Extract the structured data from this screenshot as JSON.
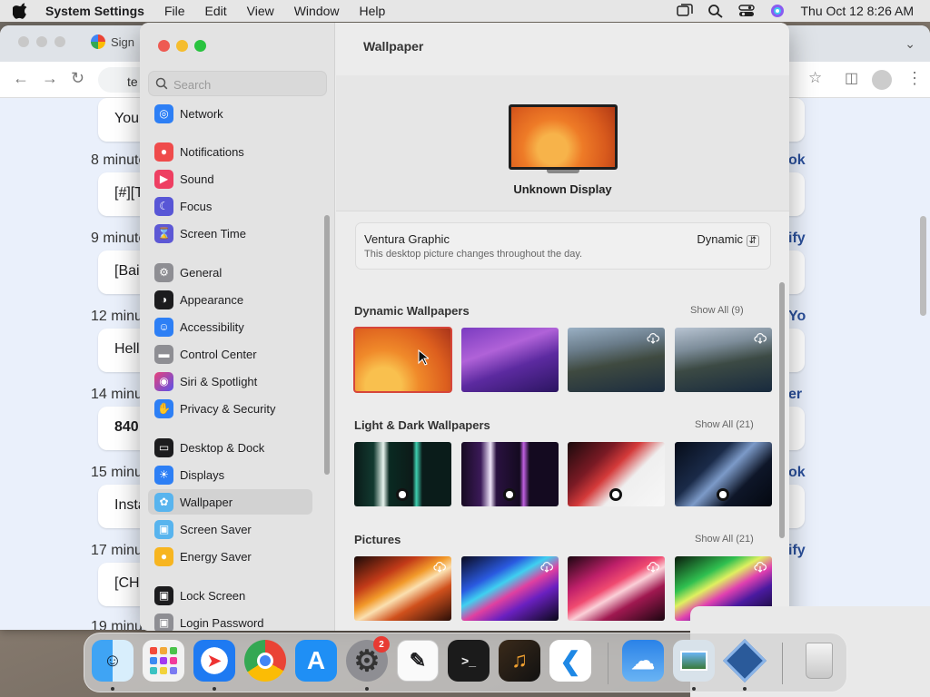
{
  "menubar": {
    "app": "System Settings",
    "items": [
      "File",
      "Edit",
      "View",
      "Window",
      "Help"
    ],
    "datetime": "Thu Oct 12  8:26 AM"
  },
  "browser": {
    "tab_label": "Sign",
    "address": "te",
    "timestamps": [
      "8 minute",
      "9 minute",
      "12 minu",
      "14 minu",
      "15 minu",
      "17 minu",
      "19 minu"
    ],
    "messages": [
      "You",
      "[#][T",
      "[Bai",
      "Hell",
      "840",
      "Insta",
      "[CH"
    ],
    "right_labels": [
      "ok",
      "ify",
      "Yo",
      "er",
      "ok",
      "ify"
    ]
  },
  "sidebar": {
    "search_placeholder": "Search",
    "items": [
      {
        "label": "Network",
        "icon": "globe-icon",
        "color": "#2d7ff5"
      },
      {
        "label": "Notifications",
        "icon": "bell-icon",
        "color": "#ef4b4b"
      },
      {
        "label": "Sound",
        "icon": "speaker-icon",
        "color": "#ee3f62"
      },
      {
        "label": "Focus",
        "icon": "moon-icon",
        "color": "#5856d6"
      },
      {
        "label": "Screen Time",
        "icon": "hourglass-icon",
        "color": "#5d58d5"
      },
      {
        "label": "General",
        "icon": "gear-icon",
        "color": "#8e8e93"
      },
      {
        "label": "Appearance",
        "icon": "appearance-icon",
        "color": "#1c1c1e"
      },
      {
        "label": "Accessibility",
        "icon": "accessibility-icon",
        "color": "#2d7ff5"
      },
      {
        "label": "Control Center",
        "icon": "toggles-icon",
        "color": "#8e8e93"
      },
      {
        "label": "Siri & Spotlight",
        "icon": "siri-icon",
        "color": "#a53dd8"
      },
      {
        "label": "Privacy & Security",
        "icon": "hand-icon",
        "color": "#2d7ff5"
      },
      {
        "label": "Desktop & Dock",
        "icon": "dock-icon",
        "color": "#1c1c1e"
      },
      {
        "label": "Displays",
        "icon": "sun-icon",
        "color": "#2d7ff5"
      },
      {
        "label": "Wallpaper",
        "icon": "wallpaper-icon",
        "color": "#58b4ee"
      },
      {
        "label": "Screen Saver",
        "icon": "screensaver-icon",
        "color": "#58b4ee"
      },
      {
        "label": "Energy Saver",
        "icon": "bulb-icon",
        "color": "#f7b520"
      },
      {
        "label": "Lock Screen",
        "icon": "lock-icon",
        "color": "#1c1c1e"
      },
      {
        "label": "Login Password",
        "icon": "padlock-icon",
        "color": "#8e8e93"
      }
    ],
    "selected": "Wallpaper"
  },
  "main": {
    "title": "Wallpaper",
    "display_name": "Unknown Display",
    "current": {
      "name": "Ventura Graphic",
      "description": "This desktop picture changes throughout the day.",
      "mode": "Dynamic"
    },
    "sections": [
      {
        "title": "Dynamic Wallpapers",
        "show_all": "Show All (9)"
      },
      {
        "title": "Light & Dark Wallpapers",
        "show_all": "Show All (21)"
      },
      {
        "title": "Pictures",
        "show_all": "Show All (21)"
      }
    ]
  },
  "dock": {
    "settings_badge": "2",
    "apps": [
      "finder-icon",
      "launchpad-icon",
      "safari-icon",
      "chrome-icon",
      "app-store-icon",
      "system-settings-icon",
      "textedit-icon",
      "terminal-icon",
      "garageband-icon",
      "vscode-icon",
      "weather-icon",
      "preview-icon",
      "virtualbox-icon",
      "trash-icon"
    ]
  }
}
